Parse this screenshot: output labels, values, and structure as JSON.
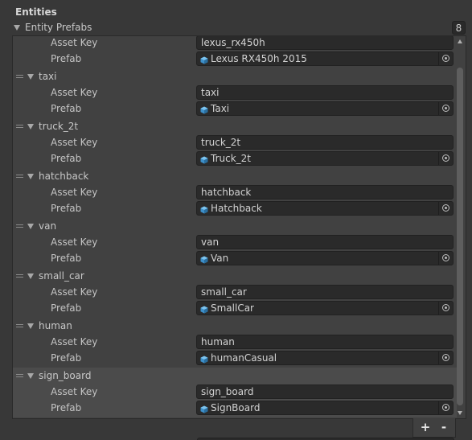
{
  "section": {
    "title": "Entities"
  },
  "list": {
    "label": "Entity Prefabs",
    "count": "8",
    "asset_key_label": "Asset Key",
    "prefab_label": "Prefab",
    "elements": [
      {
        "name": "",
        "asset_key": "lexus_rx450h",
        "prefab": "Lexus RX450h 2015"
      },
      {
        "name": "taxi",
        "asset_key": "taxi",
        "prefab": "Taxi"
      },
      {
        "name": "truck_2t",
        "asset_key": "truck_2t",
        "prefab": "Truck_2t"
      },
      {
        "name": "hatchback",
        "asset_key": "hatchback",
        "prefab": "Hatchback"
      },
      {
        "name": "van",
        "asset_key": "van",
        "prefab": "Van"
      },
      {
        "name": "small_car",
        "asset_key": "small_car",
        "prefab": "SmallCar"
      },
      {
        "name": "human",
        "asset_key": "human",
        "prefab": "humanCasual"
      },
      {
        "name": "sign_board",
        "asset_key": "sign_board",
        "prefab": "SignBoard"
      }
    ]
  },
  "footer": {
    "add_label": "+",
    "remove_label": "-"
  },
  "icons": {
    "list_fold": "triangle-down-icon",
    "element_fold": "triangle-down-icon",
    "drag": "drag-handle-icon",
    "prefab": "prefab-cube-icon",
    "picker": "object-picker-icon"
  },
  "colors": {
    "background": "#383838",
    "list_body": "#414141",
    "field": "#2a2a2a",
    "prefab_icon": "#4aa3df"
  }
}
